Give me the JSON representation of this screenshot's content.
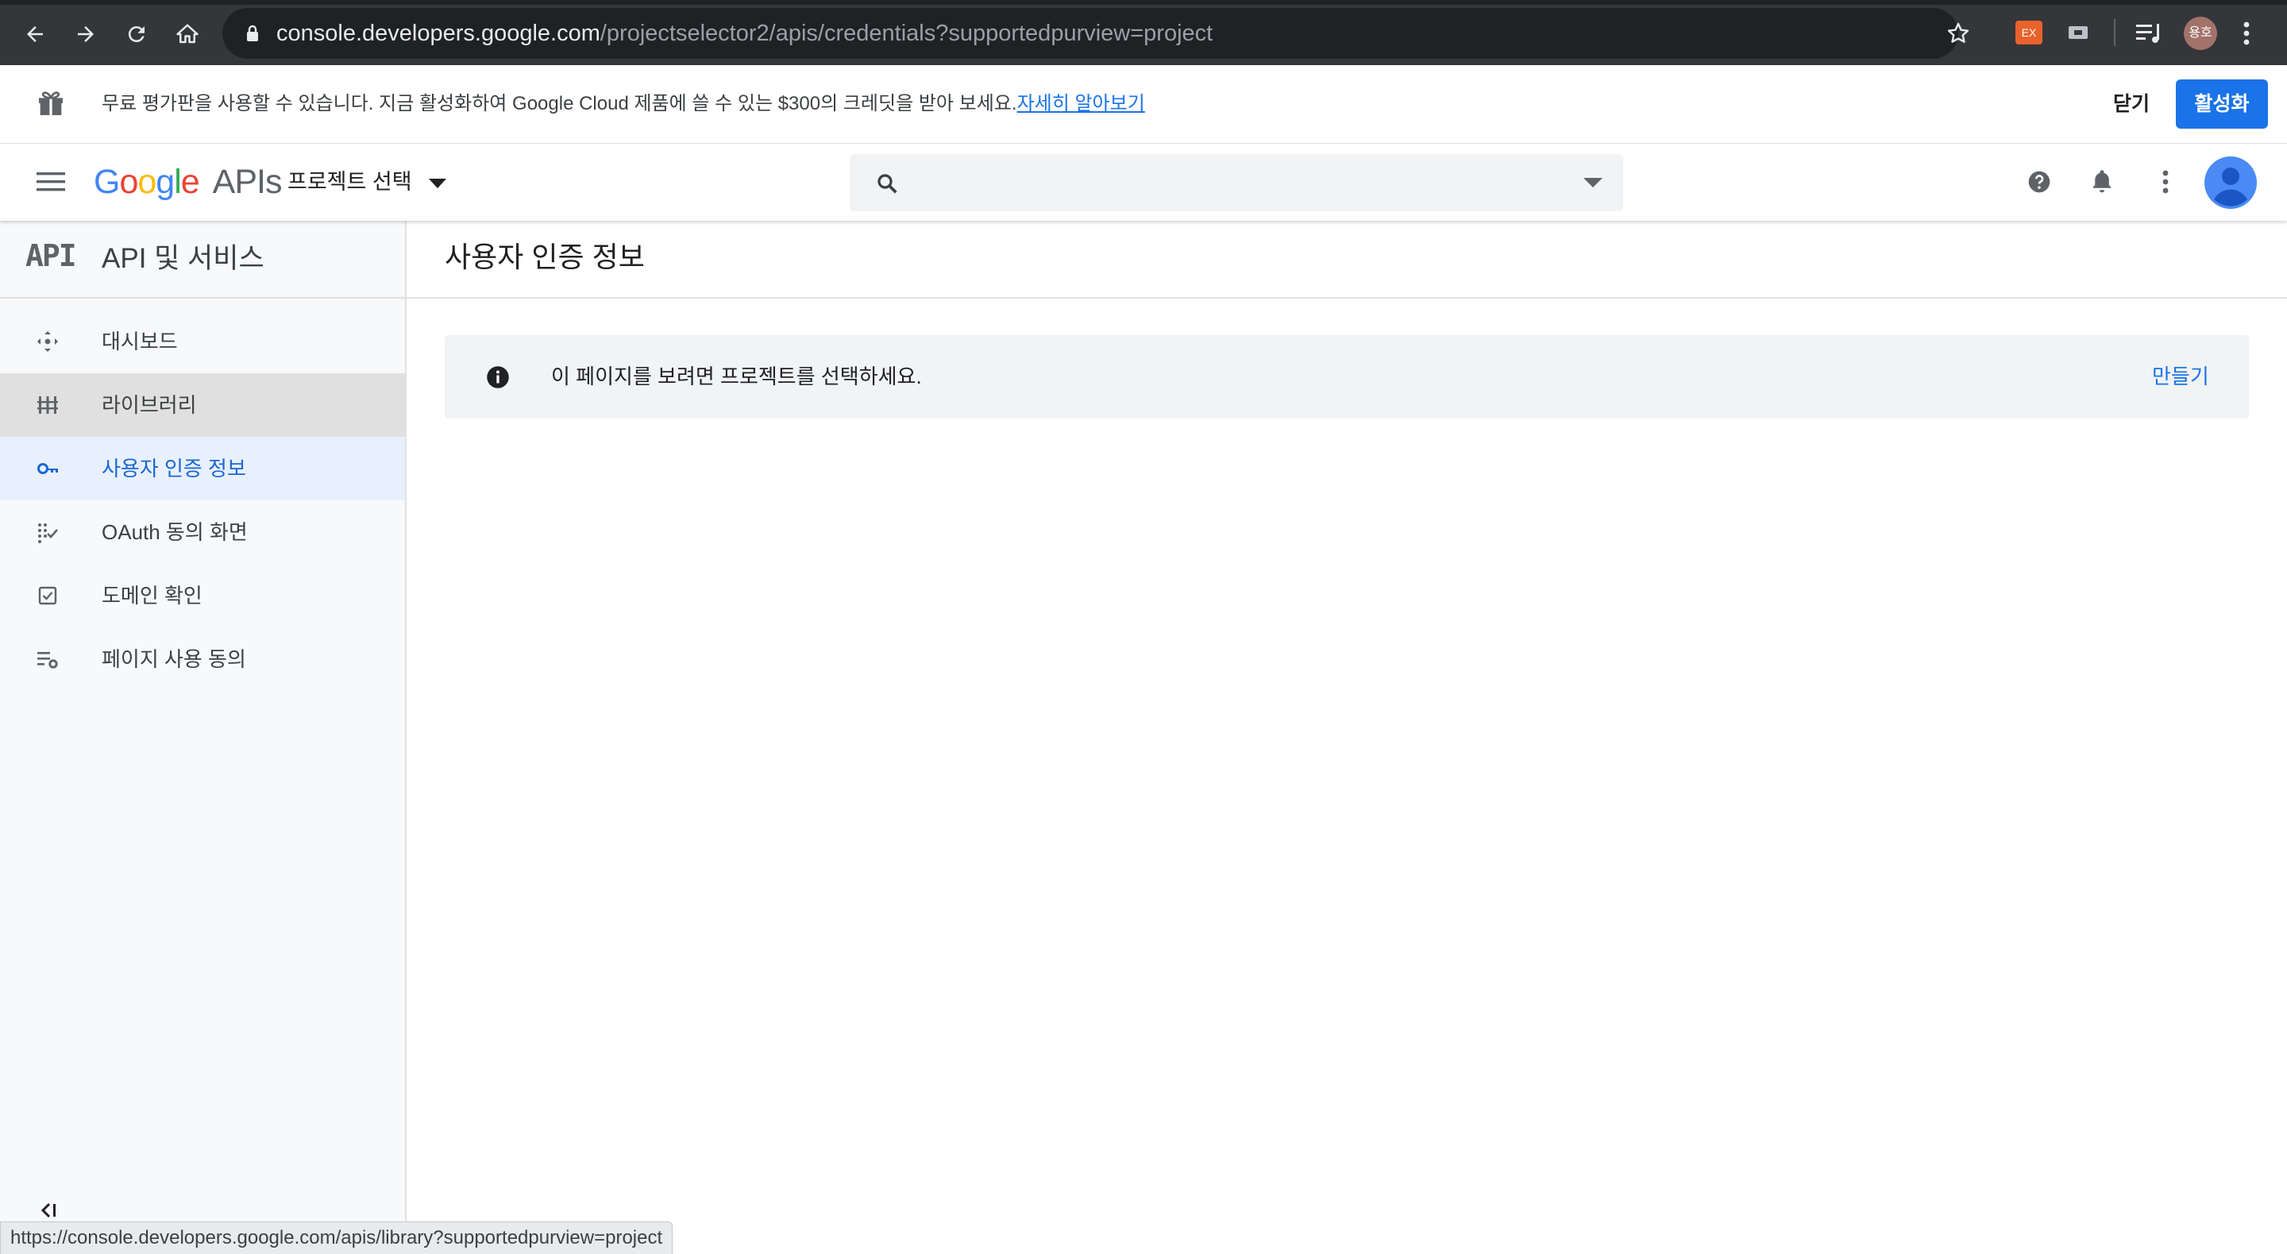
{
  "browser": {
    "url_host": "console.developers.google.com",
    "url_path": "/projectselector2/apis/credentials?supportedpurview=project",
    "profile_initials": "용호",
    "extension_label": "EX"
  },
  "promo": {
    "text": "무료 평가판을 사용할 수 있습니다. 지금 활성화하여 Google Cloud 제품에 쓸 수 있는 $300의 크레딧을 받아 보세요.",
    "link": "자세히 알아보기",
    "close": "닫기",
    "activate": "활성화"
  },
  "header": {
    "logo_apis": "APIs",
    "project_selector": "프로젝트 선택"
  },
  "sidebar": {
    "section_mark": "API",
    "title": "API 및 서비스",
    "items": [
      {
        "label": "대시보드",
        "icon": "dashboard-icon"
      },
      {
        "label": "라이브러리",
        "icon": "library-icon"
      },
      {
        "label": "사용자 인증 정보",
        "icon": "key-icon"
      },
      {
        "label": "OAuth 동의 화면",
        "icon": "oauth-icon"
      },
      {
        "label": "도메인 확인",
        "icon": "checkbox-icon"
      },
      {
        "label": "페이지 사용 동의",
        "icon": "settings-list-icon"
      }
    ],
    "collapse_glyph": "<|"
  },
  "main": {
    "title": "사용자 인증 정보",
    "notice": "이 페이지를 보려면 프로젝트를 선택하세요.",
    "create": "만들기"
  },
  "status_bar": {
    "url": "https://console.developers.google.com/apis/library?supportedpurview=project"
  },
  "colors": {
    "accent": "#1a73e8",
    "active_bg": "#e8f0fe",
    "chrome_bg": "#35363a"
  }
}
